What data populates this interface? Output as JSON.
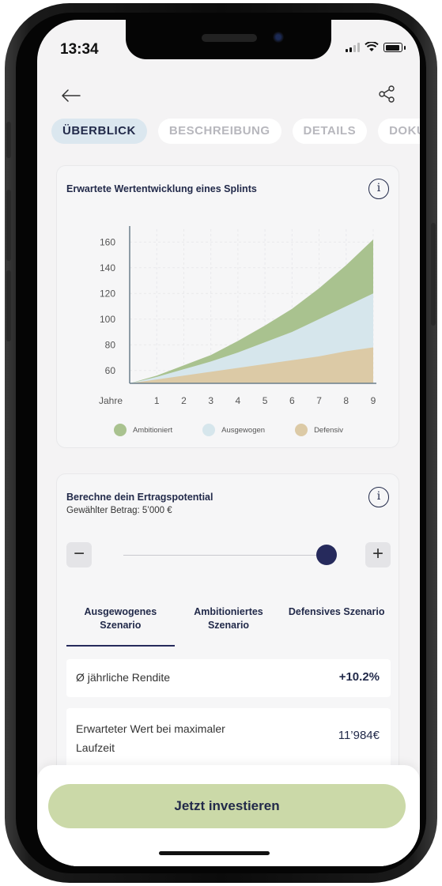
{
  "status": {
    "time": "13:34"
  },
  "tabs": [
    {
      "label": "ÜBERBLICK",
      "active": true
    },
    {
      "label": "BESCHREIBUNG",
      "active": false
    },
    {
      "label": "DETAILS",
      "active": false
    },
    {
      "label": "DOKU",
      "active": false
    }
  ],
  "chart_card": {
    "title": "Erwartete Wertentwicklung eines Splints",
    "info_icon": "info-icon"
  },
  "chart_data": {
    "type": "area",
    "title": "Erwartete Wertentwicklung eines Splints",
    "xlabel": "Jahre",
    "ylabel": "",
    "x": [
      0,
      1,
      2,
      3,
      4,
      5,
      6,
      7,
      8,
      9
    ],
    "x_tick_labels": [
      "Jahre",
      "1",
      "2",
      "3",
      "4",
      "5",
      "6",
      "7",
      "8",
      "9"
    ],
    "y_ticks": [
      60,
      80,
      100,
      120,
      140,
      160
    ],
    "ylim": [
      50,
      170
    ],
    "xlim": [
      0,
      9
    ],
    "series": [
      {
        "name": "Ambitioniert",
        "color": "#a9c28f",
        "values": [
          50,
          56,
          64,
          72,
          83,
          95,
          108,
          124,
          142,
          162
        ]
      },
      {
        "name": "Ausgewogen",
        "color": "#d6e6ec",
        "values": [
          50,
          55,
          61,
          67,
          74,
          82,
          90,
          100,
          110,
          120
        ]
      },
      {
        "name": "Defensiv",
        "color": "#dccaa6",
        "values": [
          50,
          53,
          56,
          59,
          62,
          65,
          68,
          71,
          75,
          78
        ]
      }
    ],
    "legend_placement": "bottom",
    "grid": true
  },
  "calc_card": {
    "title": "Berechne dein Ertragspotential",
    "subtitle": "Gewählter Betrag: 5’000 €",
    "minus": "−",
    "plus": "+",
    "scenarios": [
      {
        "label": "Ausgewogenes Szenario",
        "active": true
      },
      {
        "label": "Ambitioniertes Szenario",
        "active": false
      },
      {
        "label": "Defensives Szenario",
        "active": false
      }
    ],
    "rows": [
      {
        "label": "Ø jährliche Rendite",
        "value": "+10.2%"
      },
      {
        "label": "Erwarteter Wert bei maximaler Laufzeit",
        "value": "11’984€"
      }
    ]
  },
  "cta": {
    "label": "Jetzt investieren"
  }
}
